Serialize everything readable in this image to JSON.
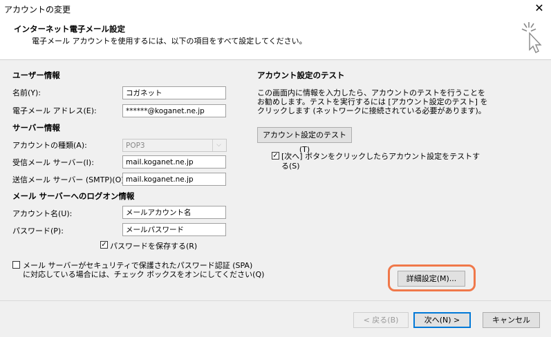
{
  "window": {
    "title": "アカウントの変更",
    "close_glyph": "✕"
  },
  "header": {
    "title": "インターネット電子メール設定",
    "subtitle": "電子メール アカウントを使用するには、以下の項目をすべて設定してください。"
  },
  "user_info": {
    "heading": "ユーザー情報",
    "name_label": "名前(Y):",
    "name_value": "コガネット",
    "email_label": "電子メール アドレス(E):",
    "email_value": "******@koganet.ne.jp"
  },
  "server_info": {
    "heading": "サーバー情報",
    "account_type_label": "アカウントの種類(A):",
    "account_type_value": "POP3",
    "incoming_label": "受信メール サーバー(I):",
    "incoming_value": "mail.koganet.ne.jp",
    "outgoing_label": "送信メール サーバー (SMTP)(O):",
    "outgoing_value": "mail.koganet.ne.jp"
  },
  "logon_info": {
    "heading": "メール サーバーへのログオン情報",
    "account_name_label": "アカウント名(U):",
    "account_name_value": "メールアカウント名",
    "password_label": "パスワード(P):",
    "password_value": "メールパスワード",
    "save_password_label": "パスワードを保存する(R)",
    "save_password_checked": true,
    "spa_line1": "メール サーバーがセキュリティで保護されたパスワード認証 (SPA)",
    "spa_line2": "に対応している場合には、チェック ボックスをオンにしてください(Q)",
    "spa_checked": false
  },
  "test": {
    "heading": "アカウント設定のテスト",
    "desc1": "この画面内に情報を入力したら、アカウントのテストを行うことを",
    "desc2": "お勧めします。テストを実行するには [アカウント設定のテスト] を",
    "desc3": "クリックします (ネットワークに接続されている必要があります)。",
    "test_button": "アカウント設定のテスト(T)",
    "auto_test_line1": "[次へ] ボタンをクリックしたらアカウント設定をテストす",
    "auto_test_line2": "る(S)",
    "auto_test_checked": true
  },
  "advanced_button": "詳細設定(M)...",
  "footer": {
    "back": "< 戻る(B)",
    "next": "次へ(N) >",
    "cancel": "キャンセル"
  },
  "colors": {
    "highlight": "#f0784a",
    "primary_border": "#0078d7"
  }
}
